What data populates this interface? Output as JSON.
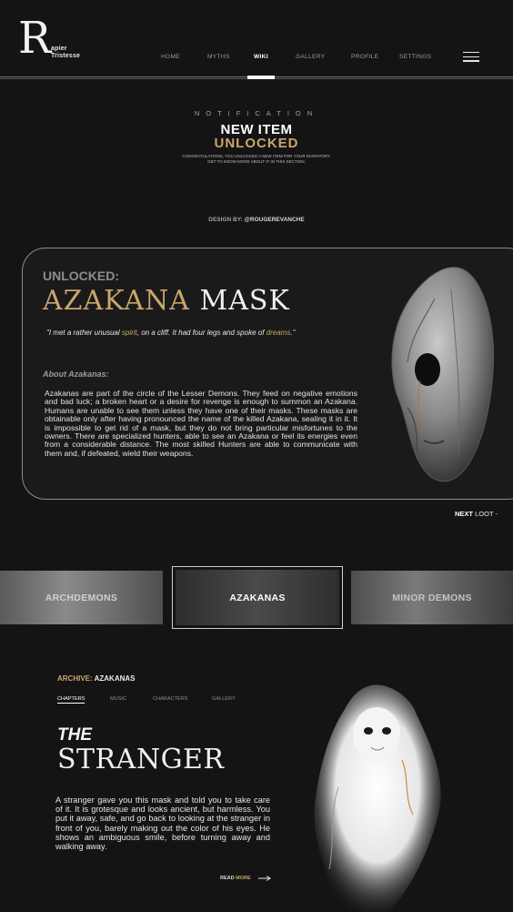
{
  "brand": {
    "initial": "R",
    "name_line1": "apier",
    "name_line2": "Tristesse"
  },
  "nav": {
    "items": [
      "HOME",
      "MYTHS",
      "WIKI",
      "GALLERY",
      "PROFILE",
      "SETTINGS"
    ],
    "active": "WIKI"
  },
  "notification": {
    "label": "NOTIFICATION",
    "title_line1": "NEW ITEM",
    "title_line2": "UNLOCKED",
    "subtitle_line1": "CONGRATULATIONS, YOU UNLOCKED A NEW ITEM FOR YOUR INVENTORY.",
    "subtitle_line2": "GET TO KNOW MORE ABOUT IT IN THIS SECTION."
  },
  "credit": {
    "label": "DESIGN BY:",
    "handle": "@ROUGEREVANCHE"
  },
  "item": {
    "status": "UNLOCKED:",
    "title_part1": "AZAKANA",
    "title_part2": "MASK",
    "quote_pre": "\"I met a rather unusual ",
    "quote_hl1": "spirit",
    "quote_mid": ", on a cliff. It had four legs and spoke of ",
    "quote_hl2": "dreams",
    "quote_post": ".\"",
    "about_heading": "About Azakanas:",
    "about_text": "Azakanas are part of the circle of the Lesser Demons. They feed on negative emotions and bad luck; a broken heart or a desire for revenge is enough to summon an Azakana. Humans are unable to see them unless they have one of their masks. These masks are obtainable only after having pronounced the name of the killed Azakana, sealing it in it. It is impossible to get rid of a mask, but they do not bring particular misfortunes to the owners. There are specialized hunters, able to see an Azakana or feel its energies even from a considerable distance. The most skilled Hunters are able to communicate with them and, if defeated, wield their weapons."
  },
  "next_loot": {
    "bold": "NEXT",
    "rest": "LOOT -"
  },
  "categories": [
    "ARCHDEMONS",
    "AZAKANAS",
    "MINOR DEMONS"
  ],
  "archive": {
    "label": "ARCHIVE:",
    "name": "AZAKANAS",
    "tabs": [
      "CHAPTERS",
      "MUSIC",
      "CHARACTERS",
      "GALLERY"
    ],
    "active_tab": "CHAPTERS",
    "story_prefix": "THE",
    "story_title": "STRANGER",
    "story_text": "A stranger gave you this mask and told you to take care of it. It is grotesque and looks ancient, but harmless. You put it away, safe, and go back to looking at the stranger in front of you, barely making out the color of his eyes. He shows an ambiguous smile, before turning away and walking away.",
    "read_label": "READ",
    "read_more": "MORE"
  },
  "colors": {
    "accent_gold": "#c9a66b",
    "background": "#141414",
    "text": "#e6e6e6"
  }
}
